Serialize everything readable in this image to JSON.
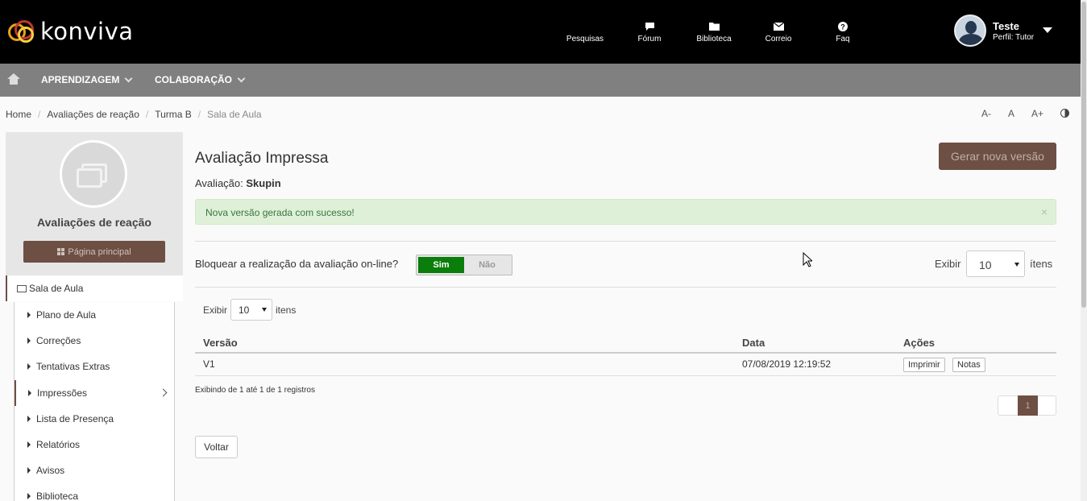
{
  "brand": {
    "name": "konviva"
  },
  "topnav": [
    {
      "label": "Pesquisas",
      "icon": "none"
    },
    {
      "label": "Fórum",
      "icon": "chat-icon"
    },
    {
      "label": "Biblioteca",
      "icon": "folder-icon"
    },
    {
      "label": "Correio",
      "icon": "mail-icon"
    },
    {
      "label": "Faq",
      "icon": "question-icon"
    }
  ],
  "user": {
    "name": "Teste",
    "role": "Perfil: Tutor"
  },
  "subnav": {
    "learning": "APRENDIZAGEM",
    "collab": "COLABORAÇÃO"
  },
  "breadcrumb": [
    "Home",
    "Avaliações de reação",
    "Turma B",
    "Sala de Aula"
  ],
  "fontctl": {
    "dec": "A-",
    "normal": "A",
    "inc": "A+"
  },
  "sidebar": {
    "title": "Avaliações de reação",
    "main_button": "Página principal",
    "section": "Sala de Aula",
    "items": [
      {
        "label": "Plano de Aula"
      },
      {
        "label": "Correções"
      },
      {
        "label": "Tentativas Extras"
      },
      {
        "label": "Impressões"
      },
      {
        "label": "Lista de Presença"
      },
      {
        "label": "Relatórios"
      },
      {
        "label": "Avisos"
      },
      {
        "label": "Biblioteca"
      }
    ]
  },
  "main": {
    "title": "Avaliação Impressa",
    "sub_label": "Avaliação:",
    "sub_value": "Skupin",
    "gen_button": "Gerar nova versão",
    "alert": "Nova versão gerada com sucesso!",
    "alert_close": "×",
    "block_label": "Bloquear a realização da avaliação on-line?",
    "toggle_on": "Sim",
    "toggle_off": "Não",
    "exibir": "Exibir",
    "per_page_top": "10",
    "itens_top": "ítens",
    "per_page_table": "10",
    "itens_table": "itens",
    "columns": [
      "Versão",
      "Data",
      "Ações"
    ],
    "rows": [
      {
        "versao": "V1",
        "data": "07/08/2019 12:19:52",
        "print": "Imprimir",
        "notes": "Notas"
      }
    ],
    "info": "Exibindo de 1 até 1 de 1 registros",
    "page": "1",
    "back": "Voltar"
  },
  "colors": {
    "accent": "#6d4f44",
    "toggle_on": "#0a7d0a",
    "topbar": "#000000",
    "subnav": "#808080"
  }
}
